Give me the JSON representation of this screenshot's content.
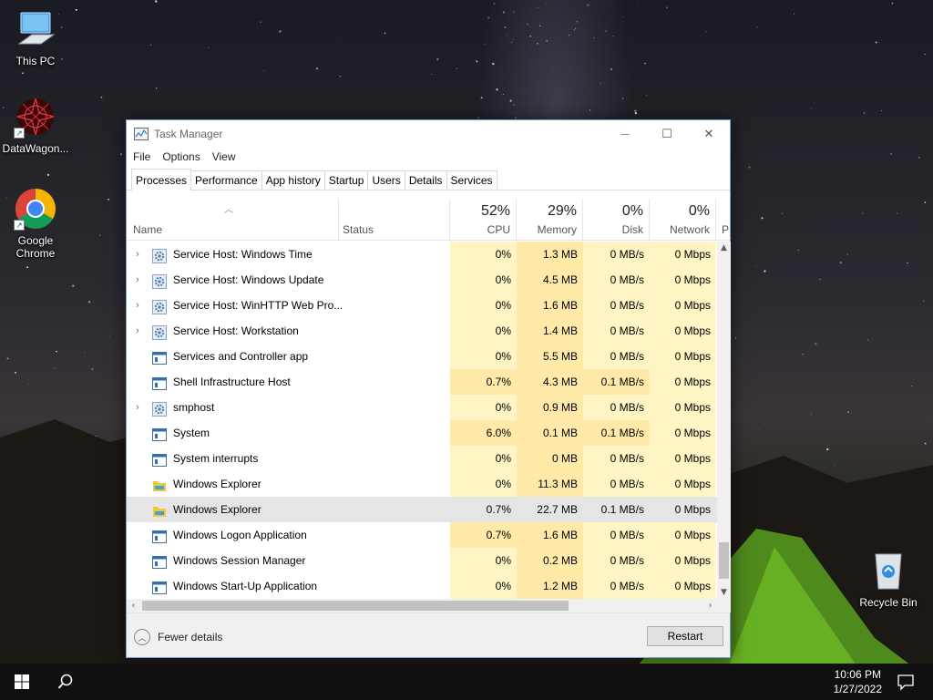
{
  "desktop": {
    "icons": [
      {
        "label": "This PC",
        "icon": "computer-icon"
      },
      {
        "label": "DataWagon...",
        "icon": "datawagon-icon"
      },
      {
        "label": "Google Chrome",
        "icon": "chrome-icon"
      },
      {
        "label": "Recycle Bin",
        "icon": "recycle-bin-icon"
      }
    ]
  },
  "window": {
    "title": "Task Manager",
    "controls": {
      "minimize": "—",
      "maximize": "☐",
      "close": "✕"
    },
    "menu": [
      "File",
      "Options",
      "View"
    ],
    "tabs": [
      "Processes",
      "Performance",
      "App history",
      "Startup",
      "Users",
      "Details",
      "Services"
    ],
    "active_tab": "Processes",
    "columns": {
      "name": "Name",
      "status": "Status",
      "cpu": {
        "pct": "52%",
        "label": "CPU"
      },
      "memory": {
        "pct": "29%",
        "label": "Memory"
      },
      "disk": {
        "pct": "0%",
        "label": "Disk"
      },
      "network": {
        "pct": "0%",
        "label": "Network"
      },
      "power_partial": "P"
    },
    "processes": [
      {
        "name": "Service Host: Windows Time",
        "expandable": true,
        "icon": "gear-icon",
        "cpu": "0%",
        "memory": "1.3 MB",
        "disk": "0 MB/s",
        "network": "0 Mbps"
      },
      {
        "name": "Service Host: Windows Update",
        "expandable": true,
        "icon": "gear-icon",
        "cpu": "0%",
        "memory": "4.5 MB",
        "disk": "0 MB/s",
        "network": "0 Mbps"
      },
      {
        "name": "Service Host: WinHTTP Web Pro...",
        "expandable": true,
        "icon": "gear-icon",
        "cpu": "0%",
        "memory": "1.6 MB",
        "disk": "0 MB/s",
        "network": "0 Mbps"
      },
      {
        "name": "Service Host: Workstation",
        "expandable": true,
        "icon": "gear-icon",
        "cpu": "0%",
        "memory": "1.4 MB",
        "disk": "0 MB/s",
        "network": "0 Mbps"
      },
      {
        "name": "Services and Controller app",
        "expandable": false,
        "icon": "app-window-icon",
        "cpu": "0%",
        "memory": "5.5 MB",
        "disk": "0 MB/s",
        "network": "0 Mbps"
      },
      {
        "name": "Shell Infrastructure Host",
        "expandable": false,
        "icon": "app-window-icon",
        "cpu": "0.7%",
        "memory": "4.3 MB",
        "disk": "0.1 MB/s",
        "network": "0 Mbps"
      },
      {
        "name": "smphost",
        "expandable": true,
        "icon": "gear-icon",
        "cpu": "0%",
        "memory": "0.9 MB",
        "disk": "0 MB/s",
        "network": "0 Mbps"
      },
      {
        "name": "System",
        "expandable": false,
        "icon": "app-window-icon",
        "cpu": "6.0%",
        "memory": "0.1 MB",
        "disk": "0.1 MB/s",
        "network": "0 Mbps"
      },
      {
        "name": "System interrupts",
        "expandable": false,
        "icon": "app-window-icon",
        "cpu": "0%",
        "memory": "0 MB",
        "disk": "0 MB/s",
        "network": "0 Mbps"
      },
      {
        "name": "Windows Explorer",
        "expandable": false,
        "icon": "folder-icon",
        "cpu": "0%",
        "memory": "11.3 MB",
        "disk": "0 MB/s",
        "network": "0 Mbps"
      },
      {
        "name": "Windows Explorer",
        "expandable": false,
        "icon": "folder-icon",
        "cpu": "0.7%",
        "memory": "22.7 MB",
        "disk": "0.1 MB/s",
        "network": "0 Mbps",
        "selected": true
      },
      {
        "name": "Windows Logon Application",
        "expandable": false,
        "icon": "app-window-icon",
        "cpu": "0.7%",
        "memory": "1.6 MB",
        "disk": "0 MB/s",
        "network": "0 Mbps"
      },
      {
        "name": "Windows Session Manager",
        "expandable": false,
        "icon": "app-window-icon",
        "cpu": "0%",
        "memory": "0.2 MB",
        "disk": "0 MB/s",
        "network": "0 Mbps"
      },
      {
        "name": "Windows Start-Up Application",
        "expandable": false,
        "icon": "app-window-icon",
        "cpu": "0%",
        "memory": "1.2 MB",
        "disk": "0 MB/s",
        "network": "0 Mbps"
      }
    ],
    "footer": {
      "fewer_details": "Fewer details",
      "restart": "Restart"
    }
  },
  "taskbar": {
    "time": "10:06 PM",
    "date": "1/27/2022"
  },
  "colors": {
    "heat_light": "#fff4c4",
    "heat_mid": "#ffe9a8",
    "selected_row": "#e5e5e5"
  }
}
